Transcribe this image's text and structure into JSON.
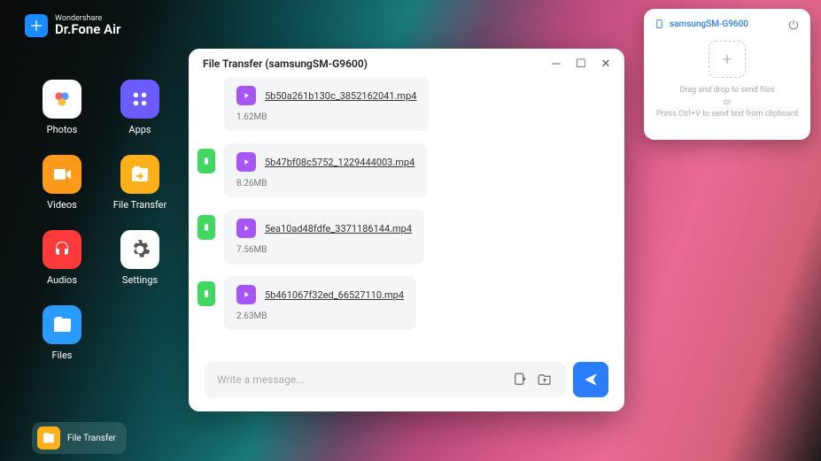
{
  "brand": {
    "sub": "Wondershare",
    "main": "Dr.Fone Air"
  },
  "launcher": {
    "items": [
      {
        "label": "Photos"
      },
      {
        "label": "Apps"
      },
      {
        "label": "Videos"
      },
      {
        "label": "File Transfer"
      },
      {
        "label": "Audios"
      },
      {
        "label": "Settings"
      },
      {
        "label": "Files"
      }
    ]
  },
  "window": {
    "title": "File Transfer (samsungSM-G9600)",
    "messages": [
      {
        "filename": "5b50a261b130c_3852162041.mp4",
        "filesize": "1.62MB"
      },
      {
        "filename": "5b47bf08c5752_1229444003.mp4",
        "filesize": "8.26MB"
      },
      {
        "filename": "5ea10ad48fdfe_3371186144.mp4",
        "filesize": "7.56MB"
      },
      {
        "filename": "5b461067f32ed_66527110.mp4",
        "filesize": "2.63MB"
      }
    ],
    "composer": {
      "placeholder": "Write a message..."
    }
  },
  "device_panel": {
    "name": "samsungSM-G9600",
    "drop_line1": "Drag and drop to send files",
    "drop_line2": "or",
    "drop_line3": "Press Ctrl+V to send text from clipboard"
  },
  "taskbar": {
    "label": "File Transfer"
  }
}
